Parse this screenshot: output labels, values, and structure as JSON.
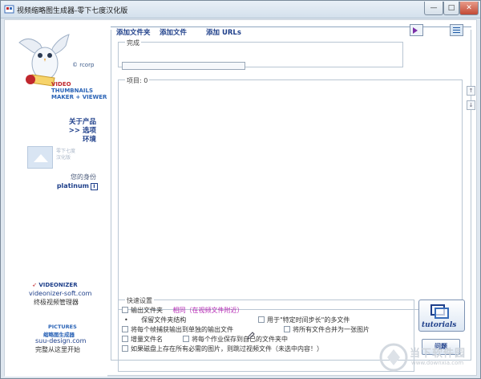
{
  "window": {
    "title": "视频缩略图生成器-零下七度汉化版",
    "min_label": "—",
    "max_label": "□",
    "close_label": "✕"
  },
  "sidebar": {
    "rcorp": "© rcorp",
    "brand_lines": [
      "VIDEO",
      "THUMBNAILS",
      "MAKER + VIEWER"
    ],
    "nav": {
      "about": "关于产品",
      "options": ">> 选项",
      "environment": "环境"
    },
    "ghost_lines": [
      "零下七度",
      "汉化版"
    ],
    "identity_label": "您的身份",
    "identity_value": "platinum",
    "identity_icon": "i",
    "videonizer_logo": "VIDEONIZER",
    "videonizer_site": "videonizer-soft.com",
    "videonizer_sub": "终极视频管理器",
    "pictures_logo": "PICTURES",
    "pictures_logo_sub": "缩略图生成器",
    "suu_site": "suu-design.com",
    "suu_sub": "完整从这里开始"
  },
  "toolbar": {
    "add_folder": "添加文件夹",
    "add_file": "添加文件",
    "add_urls": "添加 URLs"
  },
  "main": {
    "done_legend": "完成",
    "progress_fraction": 0.0,
    "items_legend": "项目: 0",
    "quick_legend": "快速设置",
    "options": {
      "output_folder": "输出文件夹",
      "same_as_video": "相同（在视频文件附近）",
      "keep_structure": "保留文件夹结构",
      "for_multiple": "用于\"特定时间步长\"的多文件",
      "each_frame_separate": "将每个帧捕获输出到单独的输出文件",
      "merge_all": "将所有文件合并为一张图片",
      "add_filename": "增量文件名",
      "save_each_job": "将每个作业保存到自己的文件夹中",
      "skip_if_exists": "如果磁盘上存在所有必需的图片，则跳过视频文件（未选中内容！）"
    },
    "bullet": "•",
    "tutorials_label": "tutorials",
    "help_label": "问题"
  },
  "watermark": {
    "text": "当下软件园",
    "url": "www.downxia.com"
  },
  "colors": {
    "link_blue": "#1e3f8a",
    "brand_red": "#c0272d",
    "magenta": "#b52ab4"
  }
}
